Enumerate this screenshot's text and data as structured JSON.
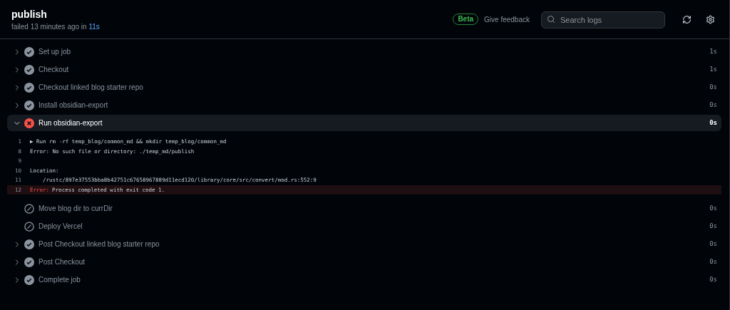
{
  "header": {
    "title": "publish",
    "subtitle_prefix": "failed 13 minutes ago in ",
    "subtitle_link": "11s",
    "badge": "Beta",
    "feedback": "Give feedback",
    "search": {
      "placeholder": "Search logs"
    }
  },
  "steps": [
    {
      "name": "Set up job",
      "kind": "success",
      "expanded": false,
      "duration": "1s"
    },
    {
      "name": "Checkout",
      "kind": "success",
      "expanded": false,
      "duration": "1s"
    },
    {
      "name": "Checkout linked blog starter repo",
      "kind": "success",
      "expanded": false,
      "duration": "0s"
    },
    {
      "name": "Install obsidian-export",
      "kind": "success",
      "expanded": false,
      "duration": "0s"
    },
    {
      "name": "Run obsidian-export",
      "kind": "failure",
      "expanded": true,
      "duration": "0s",
      "log": [
        {
          "number": "1",
          "kind": "group",
          "text": "▶ Run rm -rf temp_blog/common_md && mkdir temp_blog/common_md"
        },
        {
          "number": "8",
          "kind": "normal",
          "text": "Error: No such file or directory: ./temp_md/publish"
        },
        {
          "number": "9",
          "kind": "normal"
        },
        {
          "number": "10",
          "kind": "normal",
          "text": "Location:"
        },
        {
          "number": "11",
          "kind": "normal",
          "text": "    /rustc/897e37553bba8b42751c67658967889d11ecd120/library/core/src/convert/mod.rs:552:9"
        },
        {
          "number": "12",
          "kind": "error",
          "label": "Error:",
          "text": "Process completed with exit code 1."
        }
      ]
    },
    {
      "name": "Move blog dir to currDir",
      "kind": "skipped",
      "duration": "0s"
    },
    {
      "name": "Deploy Vercel",
      "kind": "skipped",
      "duration": "0s"
    },
    {
      "name": "Post Checkout linked blog starter repo",
      "kind": "success",
      "expanded": false,
      "duration": "0s"
    },
    {
      "name": "Post Checkout",
      "kind": "success",
      "expanded": false,
      "duration": "0s"
    },
    {
      "name": "Complete job",
      "kind": "success",
      "expanded": false,
      "duration": "0s"
    }
  ]
}
